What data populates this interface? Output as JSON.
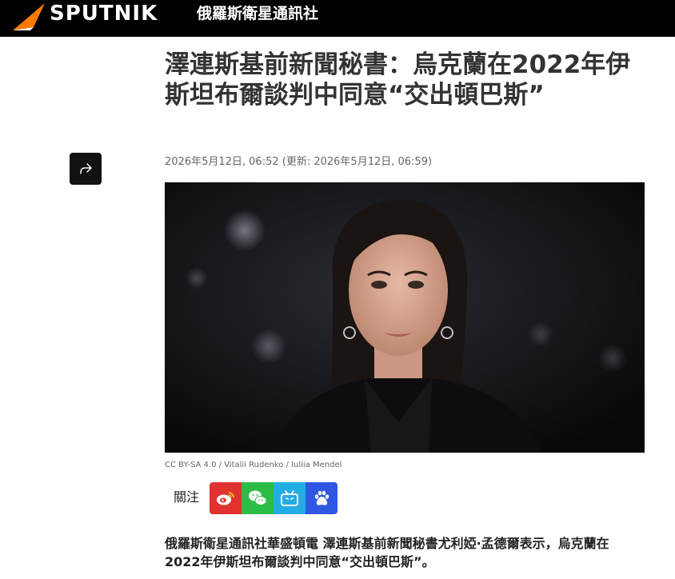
{
  "header": {
    "brand": "SPUTNIK",
    "brand_subtitle": "俄羅斯衛星通訊社",
    "brand_color": "#ff7a00"
  },
  "article": {
    "title": "澤連斯基前新聞秘書：烏克蘭在2022年伊斯坦布爾談判中同意“交出頓巴斯”",
    "dateline": "2026年5月12日, 06:52 (更新: 2026年5月12日, 06:59)",
    "photo_caption": "CC BY-SA 4.0 / Vitalii Rudenko / Iuliia Mendel",
    "lead": "俄羅斯衛星通訊社華盛頓電 澤連斯基前新聞秘書尤利婭·孟德爾表示，烏克蘭在2022年伊斯坦布爾談判中同意“交出頓巴斯”。"
  },
  "share": {
    "icon": "share-icon"
  },
  "follow": {
    "label": "關注",
    "channels": [
      {
        "name": "weibo",
        "icon": "weibo-icon",
        "color": "#e0332f"
      },
      {
        "name": "wechat",
        "icon": "wechat-icon",
        "color": "#2bbd46"
      },
      {
        "name": "bilibili",
        "icon": "bilibili-icon",
        "color": "#23ade5"
      },
      {
        "name": "baidu",
        "icon": "baidu-icon",
        "color": "#2f57e3"
      }
    ]
  }
}
